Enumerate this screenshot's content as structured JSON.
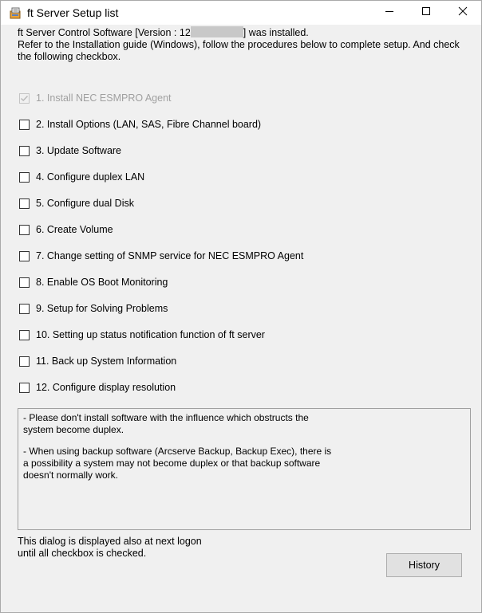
{
  "window": {
    "title": "ft Server Setup list",
    "app_icon": "setup-app-icon",
    "controls": {
      "minimize_icon": "minimize-icon",
      "maximize_icon": "maximize-icon",
      "close_icon": "close-icon"
    }
  },
  "intro": {
    "version_prefix": "ft Server Control Software [Version : 12",
    "version_suffix": "] was installed.",
    "line2": "Refer to the Installation guide (Windows), follow the procedures below to complete setup. And check the following checkbox."
  },
  "checklist": [
    {
      "label": "1. Install NEC ESMPRO Agent",
      "checked": true,
      "disabled": true
    },
    {
      "label": "2. Install Options (LAN, SAS, Fibre Channel board)",
      "checked": false,
      "disabled": false
    },
    {
      "label": "3. Update Software",
      "checked": false,
      "disabled": false
    },
    {
      "label": "4. Configure duplex LAN",
      "checked": false,
      "disabled": false
    },
    {
      "label": "5. Configure dual Disk",
      "checked": false,
      "disabled": false
    },
    {
      "label": "6. Create Volume",
      "checked": false,
      "disabled": false
    },
    {
      "label": "7. Change setting of SNMP service for NEC ESMPRO Agent",
      "checked": false,
      "disabled": false
    },
    {
      "label": "8. Enable OS Boot Monitoring",
      "checked": false,
      "disabled": false
    },
    {
      "label": "9. Setup for Solving Problems",
      "checked": false,
      "disabled": false
    },
    {
      "label": "10. Setting up status notification function of ft server",
      "checked": false,
      "disabled": false
    },
    {
      "label": "11. Back up System Information",
      "checked": false,
      "disabled": false
    },
    {
      "label": "12. Configure display resolution",
      "checked": false,
      "disabled": false
    }
  ],
  "notes": [
    "- Please don't install software with the influence which obstructs the\n   system become duplex.",
    "- When using backup software (Arcserve Backup, Backup Exec), there is\n   a possibility a system may not become duplex or that backup software\n   doesn't normally work."
  ],
  "footer": {
    "message": "This dialog is displayed also at next logon\nuntil all checkbox is checked.",
    "history_button": "History"
  },
  "colors": {
    "window_bg": "#f0f0f0",
    "titlebar_bg": "#ffffff",
    "disabled_text": "#a0a0a0",
    "button_bg": "#e1e1e1"
  }
}
